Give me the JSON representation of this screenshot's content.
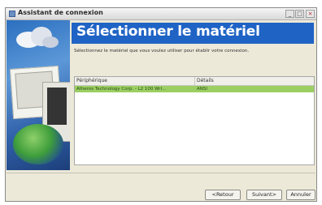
{
  "window": {
    "title": "Assistant de connexion",
    "controls": {
      "minimize": "_",
      "maximize": "□",
      "close": "×"
    }
  },
  "header": {
    "title": "Sélectionner le matériel"
  },
  "instructions": "Sélectionnez le matériel que vous voulez utiliser pour établir votre connexion.",
  "device_list": {
    "columns": [
      "Périphérique",
      "Détails"
    ],
    "rows": [
      {
        "device": "Atheros Technology Corp. - L2 100 Wrl...",
        "details": "ANSI",
        "selected": true
      }
    ],
    "selected_row_color": "#9bcf63"
  },
  "buttons": {
    "back": "<Retour",
    "next": "Suivant>",
    "cancel": "Annuler"
  },
  "colors": {
    "header": "#1f63c5"
  },
  "sidebar_art": {
    "icon": "network-wizard-illustration"
  }
}
